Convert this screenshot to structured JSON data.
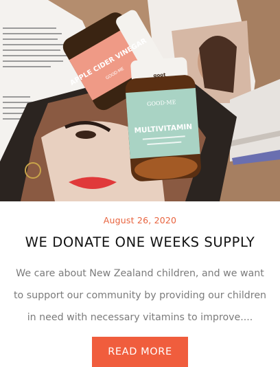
{
  "post": {
    "date": "August 26, 2020",
    "title": "WE DONATE ONE WEEKS SUPPLY",
    "excerpt": "We care about New Zealand children, and we want to support our community by providing our children in need with necessary vitamins to improve....",
    "read_more_label": "READ MORE"
  },
  "hero": {
    "bottle_front": {
      "brand": "GOOD·ME",
      "badge": "goot",
      "product": "MULTIVITAMIN"
    },
    "bottle_back": {
      "brand": "GOOD·ME",
      "product": "APPLE CIDER VINEGAR"
    }
  },
  "colors": {
    "accent": "#f05d3d",
    "date": "#e8623d",
    "title": "#111111",
    "body_text": "#7b7b7b",
    "bottle_front_label": "#a9d3c4",
    "bottle_back_label": "#ef9a86"
  }
}
